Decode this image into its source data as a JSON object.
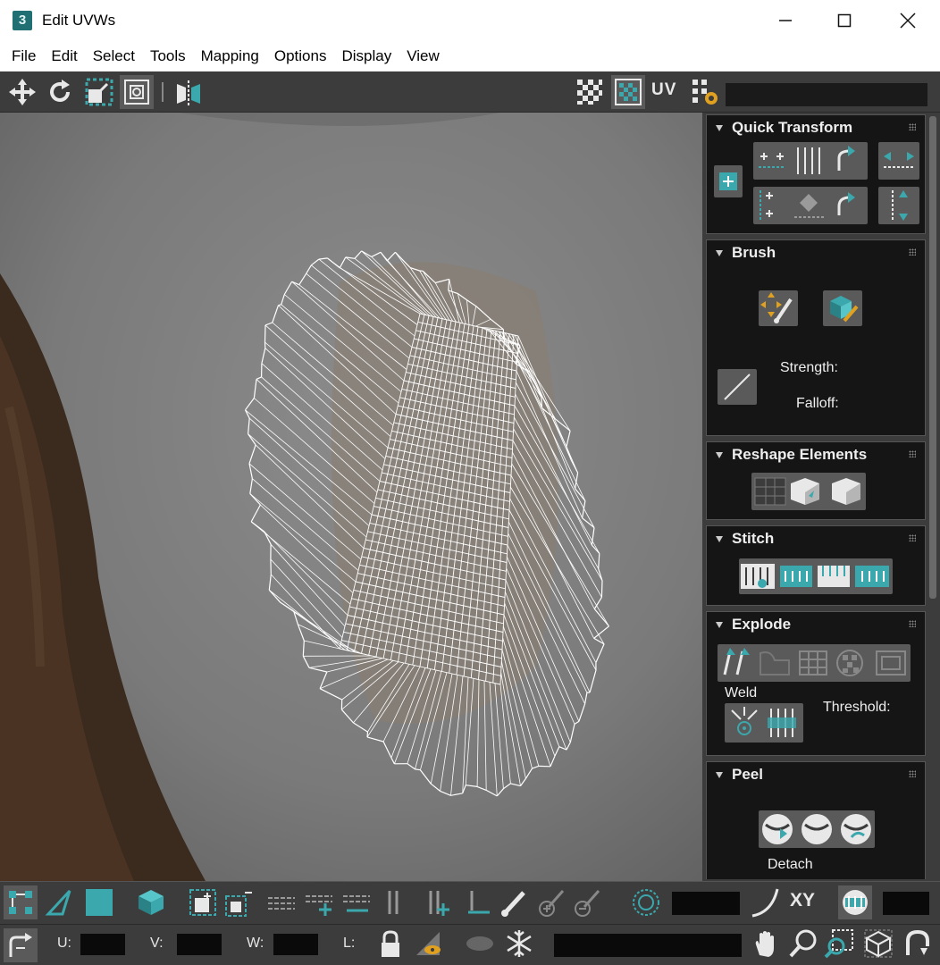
{
  "window": {
    "title": "Edit UVWs",
    "app_badge": "3"
  },
  "menu": [
    "File",
    "Edit",
    "Select",
    "Tools",
    "Mapping",
    "Options",
    "Display",
    "View"
  ],
  "top_toolbar": {
    "uv_label": "UV"
  },
  "panels": {
    "quick_transform": {
      "title": "Quick Transform"
    },
    "brush": {
      "title": "Brush",
      "strength_label": "Strength:",
      "falloff_label": "Falloff:"
    },
    "reshape": {
      "title": "Reshape Elements"
    },
    "stitch": {
      "title": "Stitch"
    },
    "explode": {
      "title": "Explode",
      "weld_label": "Weld",
      "threshold_label": "Threshold:"
    },
    "peel": {
      "title": "Peel",
      "detach_label": "Detach"
    }
  },
  "bottom_toolbar": {
    "xy_label": "XY",
    "u_label": "U:",
    "v_label": "V:",
    "w_label": "W:",
    "l_label": "L:"
  },
  "colors": {
    "accent": "#3aa8ad",
    "panel_bg": "#151515",
    "toolbar_bg": "#3c3c3c"
  }
}
